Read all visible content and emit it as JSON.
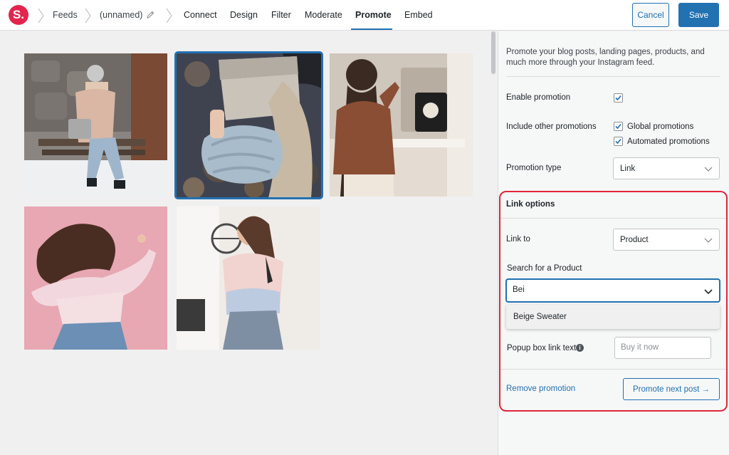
{
  "app": {
    "logo_letter": "S.",
    "brand_color": "#e2254d",
    "accent_color": "#2271b1"
  },
  "breadcrumb": {
    "feeds": "Feeds",
    "feed_name": "(unnamed)"
  },
  "tabs": [
    {
      "label": "Connect",
      "active": false
    },
    {
      "label": "Design",
      "active": false
    },
    {
      "label": "Filter",
      "active": false
    },
    {
      "label": "Moderate",
      "active": false
    },
    {
      "label": "Promote",
      "active": true
    },
    {
      "label": "Embed",
      "active": false
    }
  ],
  "header_actions": {
    "cancel": "Cancel",
    "save": "Save"
  },
  "gallery": {
    "photos": [
      {
        "subject": "woman in beanie sitting on bench in snow",
        "selected": false
      },
      {
        "subject": "hands holding book in knit sweater",
        "selected": true
      },
      {
        "subject": "woman in brown sweater at mirror",
        "selected": false
      },
      {
        "subject": "woman dancing on pink background",
        "selected": false
      },
      {
        "subject": "smiling woman in pastel sweater",
        "selected": false
      }
    ]
  },
  "panel": {
    "intro": "Promote your blog posts, landing pages, products, and much more through your Instagram feed.",
    "enable_promotion": {
      "label": "Enable promotion",
      "checked": true
    },
    "include_other": {
      "label": "Include other promotions",
      "global": {
        "label": "Global promotions",
        "checked": true
      },
      "automated": {
        "label": "Automated promotions",
        "checked": true
      }
    },
    "promotion_type": {
      "label": "Promotion type",
      "value": "Link"
    },
    "link_options": {
      "title": "Link options",
      "highlight_color": "#e0263c",
      "link_to": {
        "label": "Link to",
        "value": "Product"
      },
      "search": {
        "label": "Search for a Product",
        "value": "Bei"
      },
      "suggestion": "Beige Sweater",
      "popup_text": {
        "label": "Popup box link text",
        "placeholder": "Buy it now"
      },
      "remove": "Remove promotion",
      "next": "Promote next post →"
    }
  }
}
